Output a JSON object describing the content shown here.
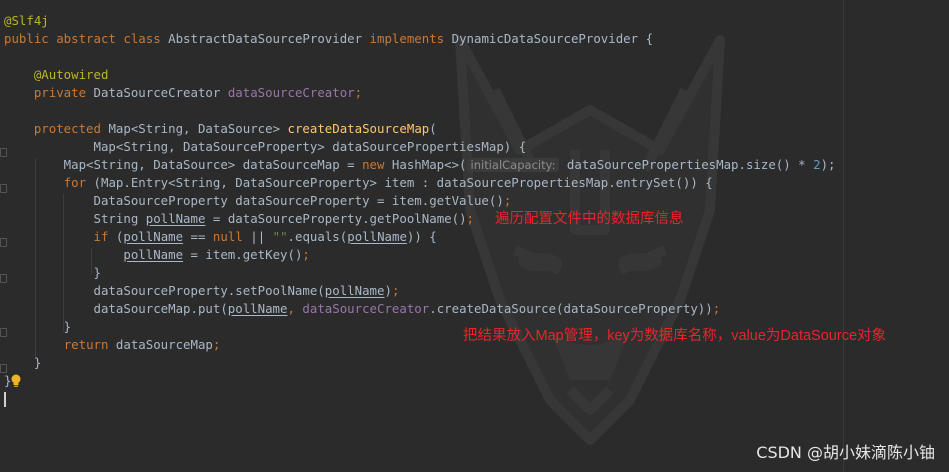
{
  "code_lines": [
    [
      {
        "t": "@Slf4j",
        "c": "ann"
      }
    ],
    [
      {
        "t": "public abstract class ",
        "c": "kw"
      },
      {
        "t": "AbstractDataSourceProvider "
      },
      {
        "t": "implements ",
        "c": "kw"
      },
      {
        "t": "DynamicDataSourceProvider {"
      }
    ],
    [],
    [
      {
        "t": "    "
      },
      {
        "t": "@Autowired",
        "c": "ann"
      }
    ],
    [
      {
        "t": "    "
      },
      {
        "t": "private ",
        "c": "kw"
      },
      {
        "t": "DataSourceCreator "
      },
      {
        "t": "dataSourceCreator",
        "c": "fld"
      },
      {
        "t": ";",
        "c": "kw"
      }
    ],
    [],
    [
      {
        "t": "    "
      },
      {
        "t": "protected ",
        "c": "kw"
      },
      {
        "t": "Map<String, DataSource> "
      },
      {
        "t": "createDataSourceMap",
        "c": "fn"
      },
      {
        "t": "("
      }
    ],
    [
      {
        "t": "            Map<String, DataSourceProperty> dataSourcePropertiesMap) {"
      }
    ],
    [
      {
        "t": "        Map<String, DataSource> dataSourceMap = "
      },
      {
        "t": "new ",
        "c": "kw"
      },
      {
        "t": "HashMap<>("
      },
      {
        "t": "initialCapacity:",
        "c": "hint"
      },
      {
        "t": " dataSourcePropertiesMap.size() * "
      },
      {
        "t": "2",
        "c": "num"
      },
      {
        "t": ");"
      }
    ],
    [
      {
        "t": "        "
      },
      {
        "t": "for ",
        "c": "kw"
      },
      {
        "t": "(Map.Entry<String, DataSourceProperty> item : dataSourcePropertiesMap.entrySet()) {"
      }
    ],
    [
      {
        "t": "            DataSourceProperty dataSourceProperty = item.getValue()"
      },
      {
        "t": ";",
        "c": "kw"
      }
    ],
    [
      {
        "t": "            String "
      },
      {
        "t": "pollName",
        "c": "ul"
      },
      {
        "t": " = dataSourceProperty.getPoolName()"
      },
      {
        "t": ";",
        "c": "kw"
      }
    ],
    [
      {
        "t": "            "
      },
      {
        "t": "if ",
        "c": "kw"
      },
      {
        "t": "("
      },
      {
        "t": "pollName",
        "c": "ul"
      },
      {
        "t": " == "
      },
      {
        "t": "null ",
        "c": "kw"
      },
      {
        "t": "|| "
      },
      {
        "t": "\"\"",
        "c": "str"
      },
      {
        "t": ".equals("
      },
      {
        "t": "pollName",
        "c": "ul"
      },
      {
        "t": ")) {"
      }
    ],
    [
      {
        "t": "                "
      },
      {
        "t": "pollName",
        "c": "ul"
      },
      {
        "t": " = item.getKey()"
      },
      {
        "t": ";",
        "c": "kw"
      }
    ],
    [
      {
        "t": "            }"
      }
    ],
    [
      {
        "t": "            dataSourceProperty.setPoolName("
      },
      {
        "t": "pollName",
        "c": "ul"
      },
      {
        "t": ")"
      },
      {
        "t": ";",
        "c": "kw"
      }
    ],
    [
      {
        "t": "            dataSourceMap.put("
      },
      {
        "t": "pollName",
        "c": "ul"
      },
      {
        "t": ", ",
        "c": "kw"
      },
      {
        "t": "dataSourceCreator",
        "c": "fld"
      },
      {
        "t": ".createDataSource(dataSourceProperty))"
      },
      {
        "t": ";",
        "c": "kw"
      }
    ],
    [
      {
        "t": "        }"
      }
    ],
    [
      {
        "t": "        "
      },
      {
        "t": "return ",
        "c": "kw"
      },
      {
        "t": "dataSourceMap"
      },
      {
        "t": ";",
        "c": "kw"
      }
    ],
    [
      {
        "t": "    }"
      }
    ],
    [
      {
        "t": "}"
      }
    ]
  ],
  "annotations": {
    "callout_1": "遍历配置文件中的数据库信息",
    "callout_2": "把结果放入Map管理，key为数据库名称，value为DataSource对象"
  },
  "watermark_text": "CSDN @胡小妹滴陈小铀",
  "icons": {
    "intention_bulb": "lightbulb-icon",
    "background": "wolf-watermark-icon"
  },
  "colors": {
    "background": "#2b2b2b",
    "keyword": "#cc7832",
    "annotation": "#bbb529",
    "field": "#9876aa",
    "method": "#ffc66d",
    "number": "#6897bb",
    "string": "#6a8759",
    "plain": "#a9b7c6",
    "callout": "#e8242d"
  }
}
